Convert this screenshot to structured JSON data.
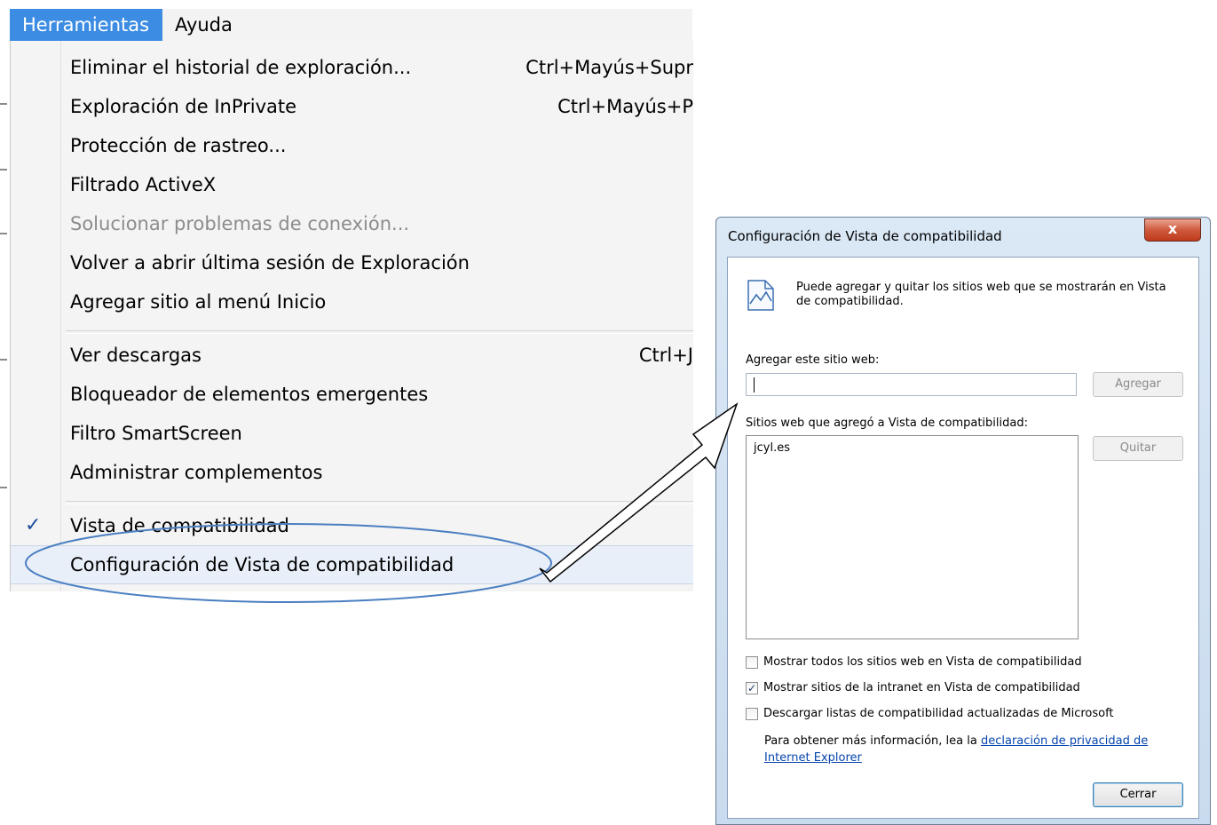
{
  "menubar": {
    "items": [
      "Herramientas",
      "Ayuda"
    ]
  },
  "menu": {
    "items": [
      {
        "label": "Eliminar el historial de exploración...",
        "shortcut": "Ctrl+Mayús+Supr"
      },
      {
        "label": "Exploración de InPrivate",
        "shortcut": "Ctrl+Mayús+P"
      },
      {
        "label": "Protección de rastreo..."
      },
      {
        "label": "Filtrado ActiveX"
      },
      {
        "label": "Solucionar problemas de conexión...",
        "disabled": true
      },
      {
        "label": "Volver a abrir última sesión de Exploración"
      },
      {
        "label": "Agregar sitio al menú Inicio"
      },
      {
        "label": "Ver descargas",
        "shortcut": "Ctrl+J"
      },
      {
        "label": "Bloqueador de elementos emergentes"
      },
      {
        "label": "Filtro SmartScreen"
      },
      {
        "label": "Administrar complementos"
      },
      {
        "label": "Vista de compatibilidad",
        "checked": true
      },
      {
        "label": "Configuración de Vista de compatibilidad",
        "highlighted": true
      }
    ],
    "check_glyph": "✓"
  },
  "dialog": {
    "title": "Configuración de Vista de compatibilidad",
    "close_glyph": "x",
    "info_icon": "compatibility-page-icon",
    "info_text": "Puede agregar y quitar los sitios web que se mostrarán en Vista de compatibilidad.",
    "add_label": "Agregar este sitio web:",
    "add_input_value": "",
    "add_button": "Agregar",
    "sites_label": "Sitios web que agregó a Vista de compatibilidad:",
    "sites": [
      "jcyl.es"
    ],
    "remove_button": "Quitar",
    "checkboxes": [
      {
        "label": "Mostrar todos los sitios web en Vista de compatibilidad",
        "checked": false
      },
      {
        "label": "Mostrar sitios de la intranet en Vista de compatibilidad",
        "checked": true
      },
      {
        "label": "Descargar listas de compatibilidad actualizadas de Microsoft",
        "checked": false
      }
    ],
    "more_info_prefix": "Para obtener más información, lea la ",
    "more_info_link": "declaración de privacidad de Internet Explorer",
    "close_button": "Cerrar"
  },
  "colors": {
    "menu_active": "#3c8ce3",
    "annotation": "#4a7fc1",
    "link": "#0645ad"
  }
}
